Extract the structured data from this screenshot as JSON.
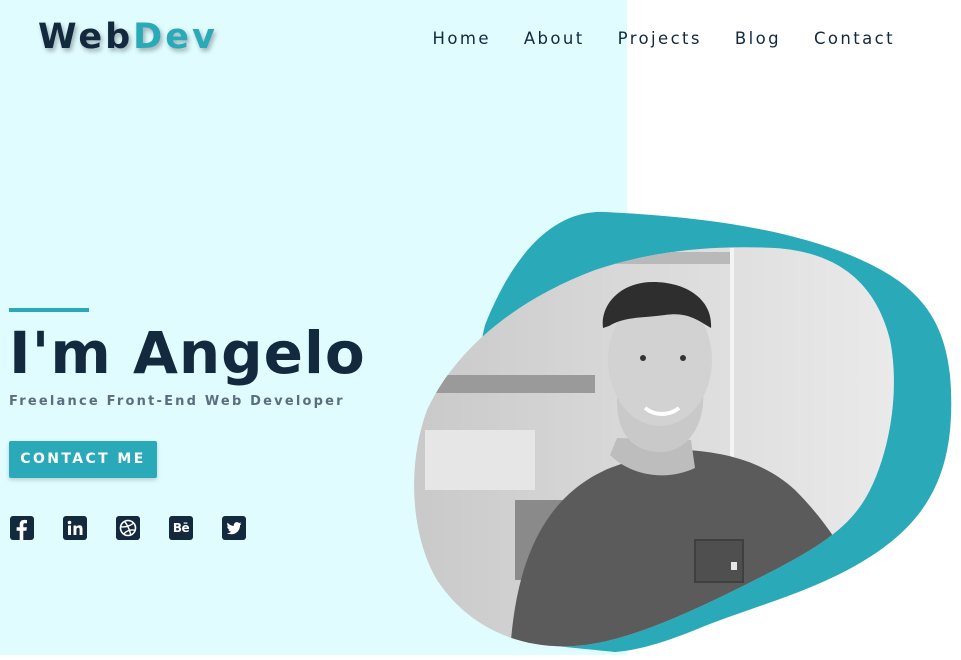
{
  "header": {
    "logo": {
      "part1": "Web",
      "part2": "Dev"
    },
    "nav": [
      {
        "label": "Home"
      },
      {
        "label": "About"
      },
      {
        "label": "Projects"
      },
      {
        "label": "Blog"
      },
      {
        "label": "Contact"
      }
    ]
  },
  "hero": {
    "title": "I'm Angelo",
    "subtitle": "Freelance Front-End Web Developer",
    "cta_label": "CONTACT ME",
    "socials": [
      {
        "icon": "facebook-icon"
      },
      {
        "icon": "linkedin-icon"
      },
      {
        "icon": "dribbble-icon"
      },
      {
        "icon": "behance-icon",
        "text": "Bē"
      },
      {
        "icon": "twitter-icon"
      }
    ],
    "photo": "portrait-photo"
  },
  "colors": {
    "navy": "#13293d",
    "teal": "#2aaab8",
    "light_cyan": "#e0fcff",
    "subtitle_gray": "#5b6d7e"
  }
}
